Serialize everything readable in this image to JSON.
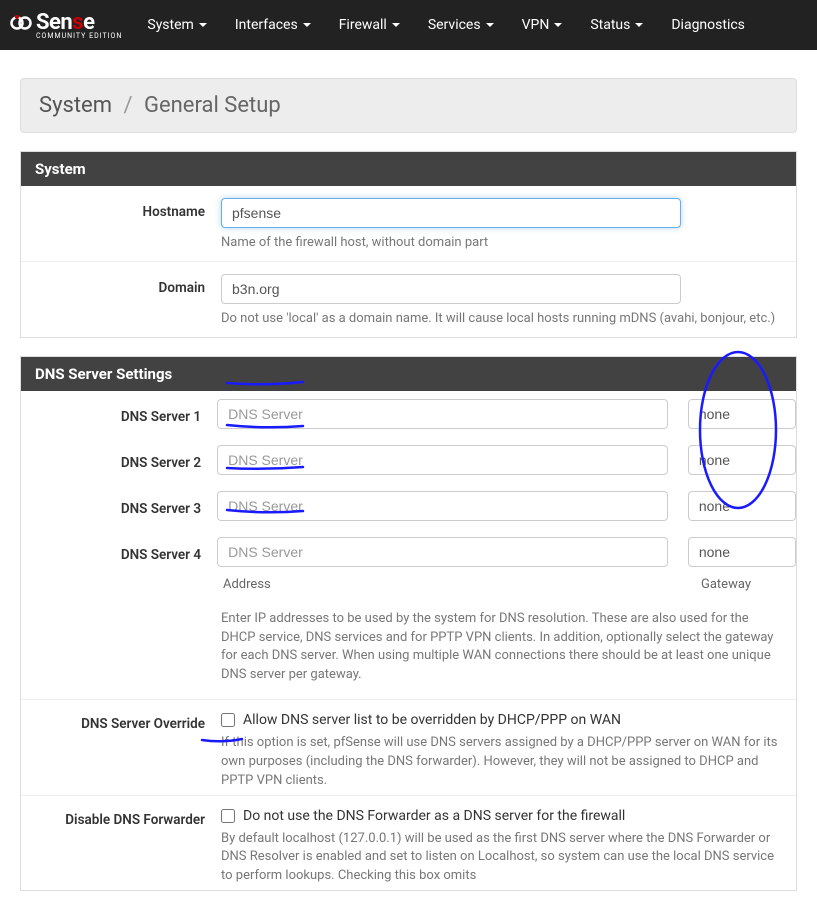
{
  "nav": {
    "items": [
      "System",
      "Interfaces",
      "Firewall",
      "Services",
      "VPN",
      "Status",
      "Diagnostics"
    ]
  },
  "breadcrumb": {
    "root": "System",
    "page": "General Setup"
  },
  "system_panel": {
    "title": "System",
    "hostname": {
      "label": "Hostname",
      "value": "pfsense",
      "help": "Name of the firewall host, without domain part"
    },
    "domain": {
      "label": "Domain",
      "value": "b3n.org",
      "help": "Do not use 'local' as a domain name. It will cause local hosts running mDNS (avahi, bonjour, etc.)"
    }
  },
  "dns_panel": {
    "title": "DNS Server Settings",
    "placeholder": "DNS Server",
    "servers": [
      {
        "label": "DNS Server 1",
        "value": "",
        "gateway": "none"
      },
      {
        "label": "DNS Server 2",
        "value": "",
        "gateway": "none"
      },
      {
        "label": "DNS Server 3",
        "value": "",
        "gateway": "none"
      },
      {
        "label": "DNS Server 4",
        "value": "",
        "gateway": "none"
      }
    ],
    "col_address": "Address",
    "col_gateway": "Gateway",
    "help": "Enter IP addresses to be used by the system for DNS resolution. These are also used for the DHCP service, DNS services and for PPTP VPN clients. In addition, optionally select the gateway for each DNS server. When using multiple WAN connections there should be at least one unique DNS server per gateway.",
    "override": {
      "label": "DNS Server Override",
      "chk": "Allow DNS server list to be overridden by DHCP/PPP on WAN",
      "help": "If this option is set, pfSense will use DNS servers assigned by a DHCP/PPP server on WAN for its own purposes (including the DNS forwarder). However, they will not be assigned to DHCP and PPTP VPN clients."
    },
    "disable_fwd": {
      "label": "Disable DNS Forwarder",
      "chk": "Do not use the DNS Forwarder as a DNS server for the firewall",
      "help": "By default localhost (127.0.0.1) will be used as the first DNS server where the DNS Forwarder or DNS Resolver is enabled and set to listen on Localhost, so system can use the local DNS service to perform lookups. Checking this box omits"
    }
  },
  "logo": {
    "brand1": "Sen",
    "brand2": "s",
    "brand3": "e",
    "sub": "COMMUNITY EDITION"
  }
}
